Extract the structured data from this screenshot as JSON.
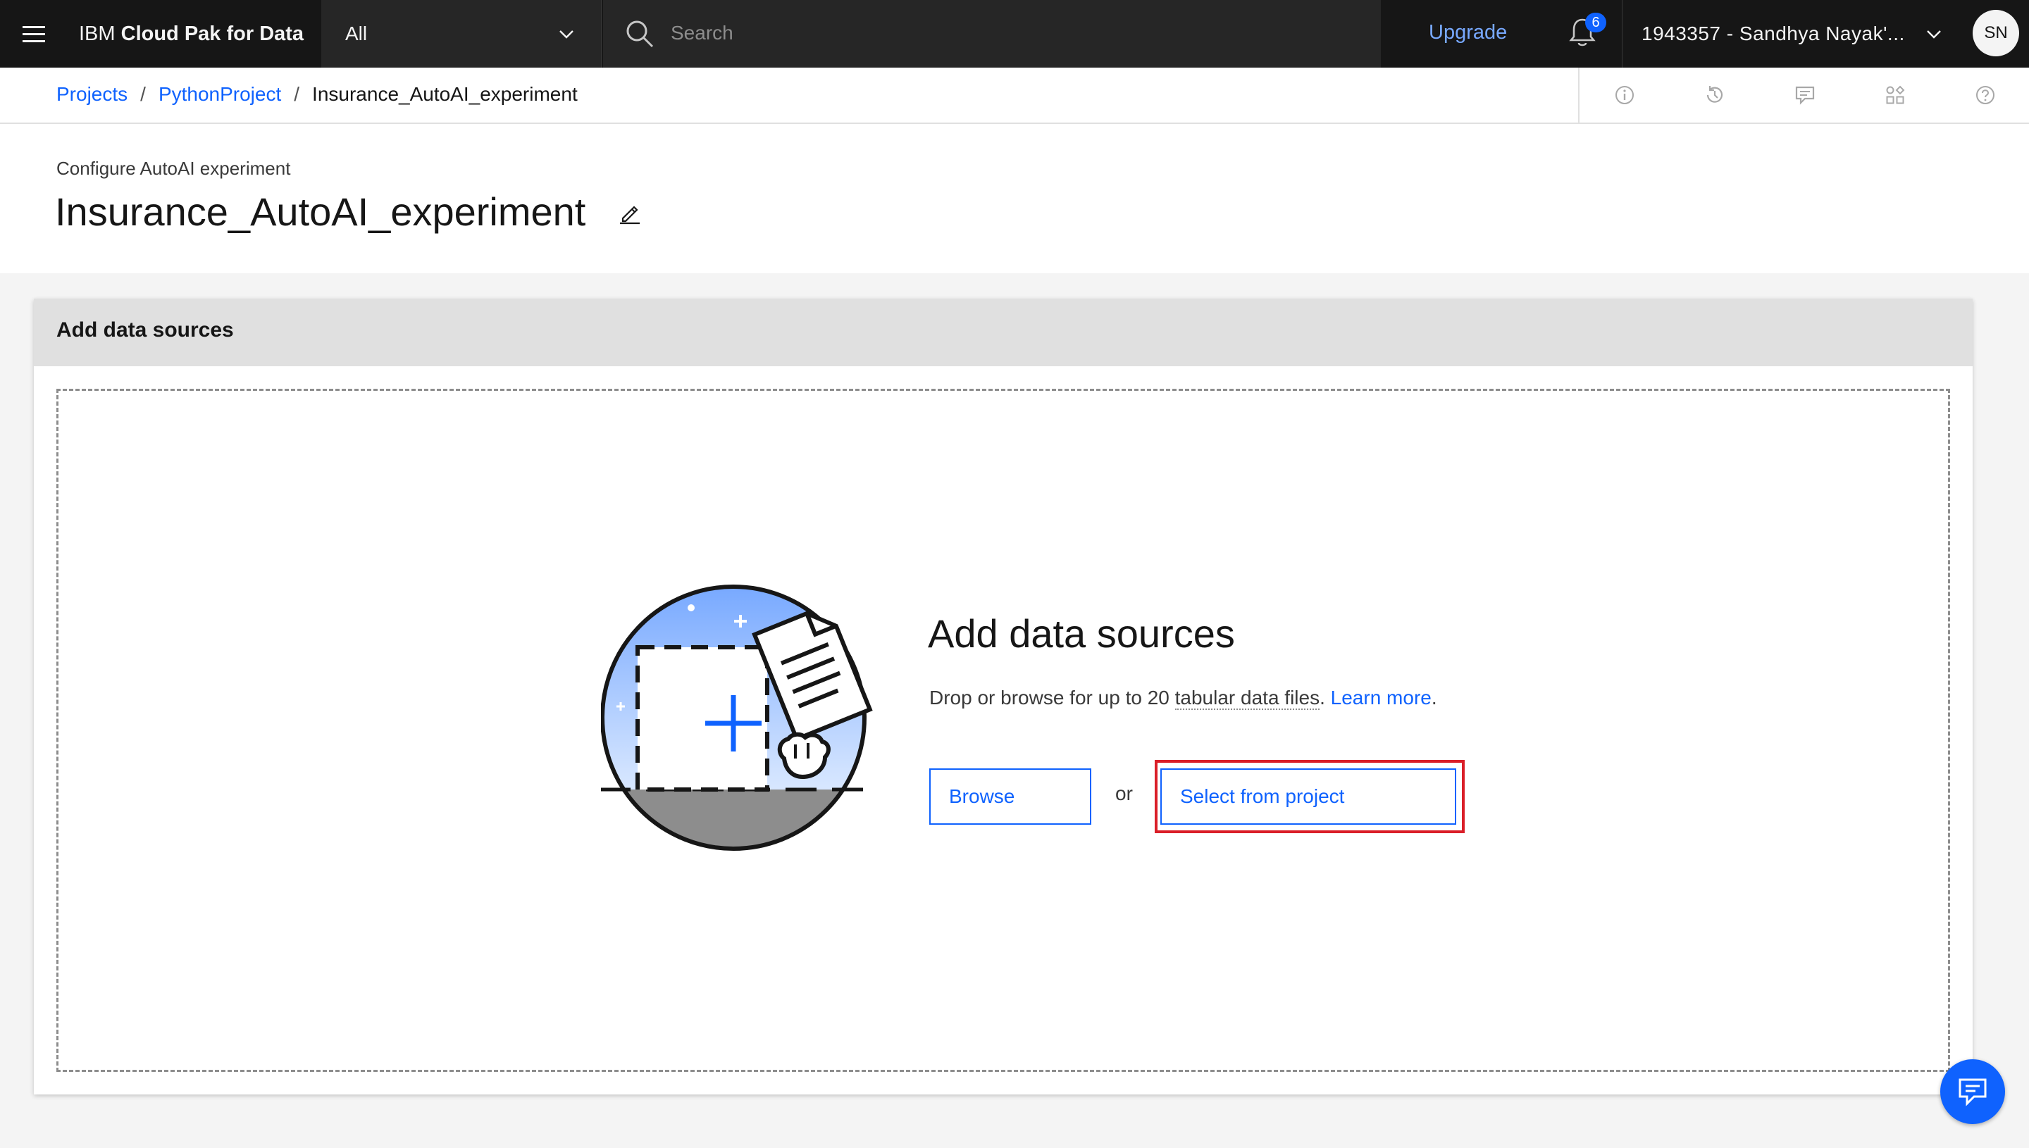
{
  "header": {
    "brand_prefix": "IBM ",
    "brand_bold": "Cloud Pak for Data",
    "scope_value": "All",
    "search_placeholder": "Search",
    "upgrade_label": "Upgrade",
    "notifications_count": "6",
    "account_name": "1943357 - Sandhya Nayak'...",
    "avatar_initials": "SN"
  },
  "breadcrumb": {
    "items": [
      "Projects",
      "PythonProject"
    ],
    "separator": "/",
    "current": "Insurance_AutoAI_experiment"
  },
  "toolbar_icons": [
    "info-icon",
    "history-icon",
    "comment-icon",
    "tools-icon",
    "help-icon"
  ],
  "page": {
    "subtitle": "Configure AutoAI experiment",
    "title": "Insurance_AutoAI_experiment"
  },
  "card": {
    "heading": "Add data sources",
    "dropzone": {
      "title": "Add data sources",
      "desc_before": "Drop or browse for up to 20 ",
      "desc_dotted": "tabular data files",
      "desc_after": ".",
      "learn_more": "Learn more",
      "learn_more_after": ".",
      "browse_label": "Browse",
      "or_label": "or",
      "select_label": "Select from project"
    }
  },
  "colors": {
    "primary": "#0f62fe",
    "highlight": "#da1e28",
    "topbar": "#161616",
    "upgrade": "#78a9ff"
  }
}
